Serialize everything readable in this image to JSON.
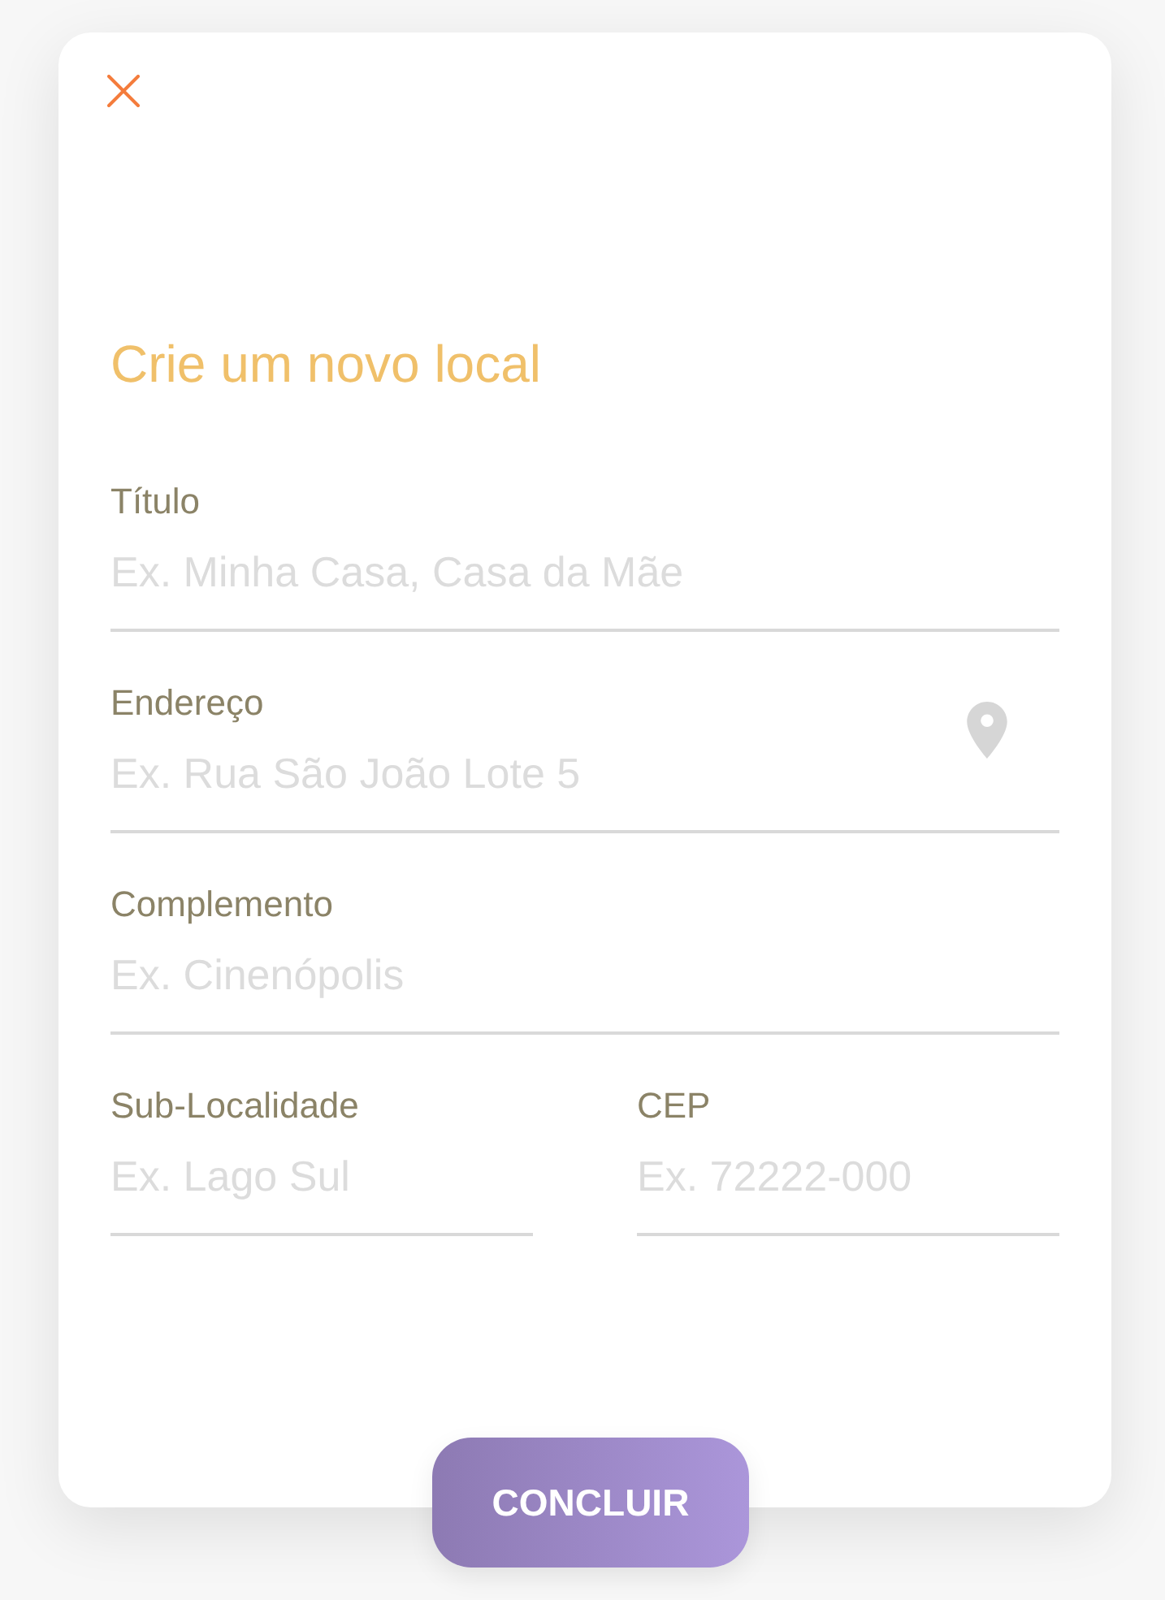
{
  "dialog": {
    "title": "Crie um novo local",
    "rows": [
      {
        "fields": [
          {
            "kind": "text",
            "label": "Título",
            "placeholder": "Ex. Minha Casa, Casa da Mãe"
          }
        ]
      },
      {
        "fields": [
          {
            "kind": "location",
            "label": "Endereço",
            "placeholder": "Ex. Rua São João Lote 5"
          }
        ]
      },
      {
        "fields": [
          {
            "kind": "text",
            "label": "Complemento",
            "placeholder": "Ex. Cinenópolis"
          }
        ]
      },
      {
        "fields": [
          {
            "kind": "text",
            "label": "Sub-Localidade",
            "placeholder": "Ex. Lago Sul"
          },
          {
            "kind": "text",
            "label": "CEP",
            "placeholder": "Ex. 72222-000"
          }
        ]
      }
    ],
    "submit_button": {
      "label": "CONCLUIR"
    }
  }
}
